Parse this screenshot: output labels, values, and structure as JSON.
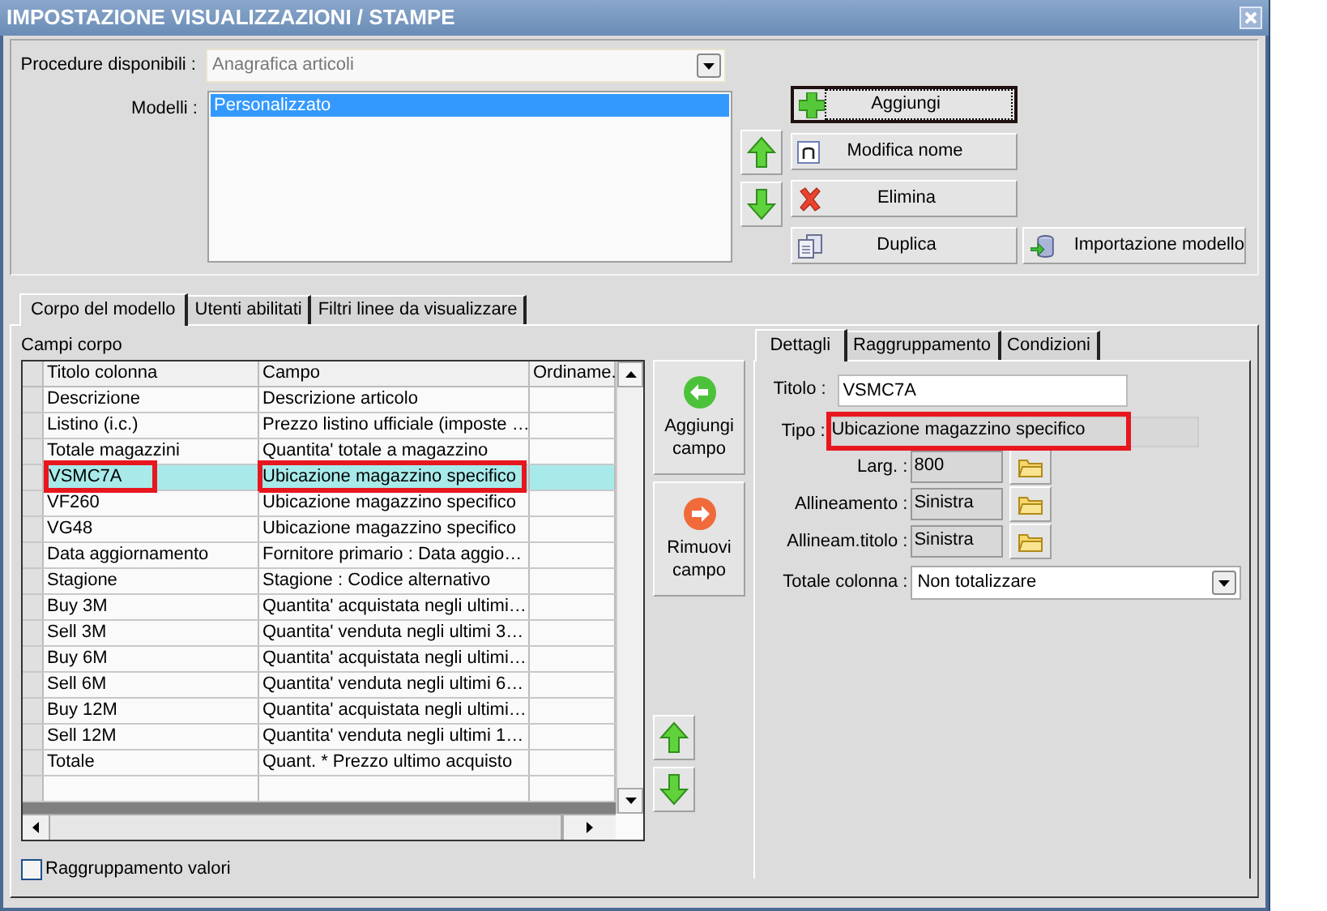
{
  "window": {
    "title": "IMPOSTAZIONE VISUALIZZAZIONI / STAMPE"
  },
  "procedure": {
    "label": "Procedure disponibili :",
    "value": "Anagrafica articoli"
  },
  "models": {
    "label": "Modelli :",
    "items": [
      {
        "text": "Personalizzato",
        "selected": true
      }
    ]
  },
  "model_buttons": [
    {
      "label": "Aggiungi",
      "kind": "add",
      "focused": true
    },
    {
      "label": "Modifica nome",
      "kind": "rename",
      "focused": false
    },
    {
      "label": "Elimina",
      "kind": "delete",
      "focused": false
    },
    {
      "label": "Duplica",
      "kind": "duplicate",
      "focused": false
    }
  ],
  "import_button": {
    "label": "Importazione modello"
  },
  "tabs": [
    {
      "label": "Corpo del modello",
      "selected": true
    },
    {
      "label": "Utenti abilitati",
      "selected": false
    },
    {
      "label": "Filtri linee da visualizzare",
      "selected": false
    }
  ],
  "fields_group": {
    "title": "Campi corpo"
  },
  "table": {
    "columns": [
      "Titolo colonna",
      "Campo",
      "Ordiname."
    ],
    "rows": [
      {
        "title": "Descrizione",
        "field": "Descrizione articolo",
        "selected": false,
        "highlighted": false
      },
      {
        "title": "Listino (i.c.)",
        "field": "Prezzo listino ufficiale (imposte …",
        "selected": false,
        "highlighted": false
      },
      {
        "title": "Totale magazzini",
        "field": "Quantita' totale a magazzino",
        "selected": false,
        "highlighted": false
      },
      {
        "title": "VSMC7A",
        "field": "Ubicazione magazzino specifico",
        "selected": true,
        "highlighted": true
      },
      {
        "title": "VF260",
        "field": "Ubicazione magazzino specifico",
        "selected": false,
        "highlighted": false
      },
      {
        "title": "VG48",
        "field": "Ubicazione magazzino specifico",
        "selected": false,
        "highlighted": false
      },
      {
        "title": "Data aggiornamento",
        "field": "Fornitore primario : Data aggio…",
        "selected": false,
        "highlighted": false
      },
      {
        "title": "Stagione",
        "field": "Stagione : Codice alternativo",
        "selected": false,
        "highlighted": false
      },
      {
        "title": "Buy 3M",
        "field": "Quantita' acquistata negli ultimi…",
        "selected": false,
        "highlighted": false
      },
      {
        "title": "Sell 3M",
        "field": "Quantita' venduta negli ultimi 3…",
        "selected": false,
        "highlighted": false
      },
      {
        "title": "Buy 6M",
        "field": "Quantita' acquistata negli ultimi…",
        "selected": false,
        "highlighted": false
      },
      {
        "title": "Sell 6M",
        "field": "Quantita' venduta negli ultimi 6…",
        "selected": false,
        "highlighted": false
      },
      {
        "title": "Buy 12M",
        "field": "Quantita' acquistata negli ultimi…",
        "selected": false,
        "highlighted": false
      },
      {
        "title": "Sell 12M",
        "field": "Quantita' venduta negli ultimi 1…",
        "selected": false,
        "highlighted": false
      },
      {
        "title": "Totale",
        "field": "Quant. * Prezzo ultimo acquisto",
        "selected": false,
        "highlighted": false
      }
    ]
  },
  "field_buttons": [
    {
      "label": "Aggiungi campo",
      "kind": "add"
    },
    {
      "label": "Rimuovi campo",
      "kind": "remove"
    }
  ],
  "group_values": {
    "label": "Raggruppamento valori",
    "checked": false
  },
  "detail_tabs": [
    {
      "label": "Dettagli",
      "selected": true
    },
    {
      "label": "Raggruppamento",
      "selected": false
    },
    {
      "label": "Condizioni",
      "selected": false
    }
  ],
  "details": {
    "title": {
      "label": "Titolo :",
      "value": "VSMC7A"
    },
    "type": {
      "label": "Tipo :",
      "value": "Ubicazione magazzino specifico",
      "highlighted": true
    },
    "props": [
      {
        "label": "Larg. :",
        "value": "800"
      },
      {
        "label": "Allineamento :",
        "value": "Sinistra"
      },
      {
        "label": "Allineam.titolo :",
        "value": "Sinistra"
      }
    ],
    "total": {
      "label": "Totale colonna :",
      "value": "Non totalizzare"
    }
  }
}
